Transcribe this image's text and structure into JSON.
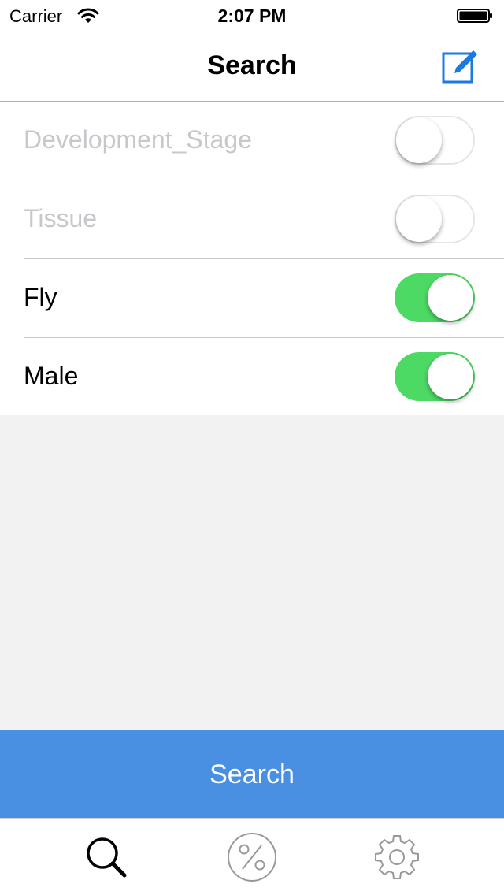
{
  "status_bar": {
    "carrier": "Carrier",
    "time": "2:07 PM",
    "icons": [
      "wifi-icon",
      "battery-icon"
    ]
  },
  "nav": {
    "title": "Search",
    "right_icon": "compose-icon"
  },
  "filters": [
    {
      "label": "Development_Stage",
      "enabled": false,
      "toggle_on": false
    },
    {
      "label": "Tissue",
      "enabled": false,
      "toggle_on": false
    },
    {
      "label": "Fly",
      "enabled": true,
      "toggle_on": true
    },
    {
      "label": "Male",
      "enabled": true,
      "toggle_on": true
    }
  ],
  "search_button": {
    "label": "Search"
  },
  "tabs": [
    {
      "icon": "search-icon",
      "selected": true
    },
    {
      "icon": "percent-icon",
      "selected": false
    },
    {
      "icon": "gear-icon",
      "selected": false
    }
  ],
  "colors": {
    "accent": "#4a90e2",
    "toggle_on": "#4cd964",
    "disabled_text": "#c7c7cc",
    "background": "#f2f2f2",
    "compose_icon": "#1a7ae0"
  }
}
